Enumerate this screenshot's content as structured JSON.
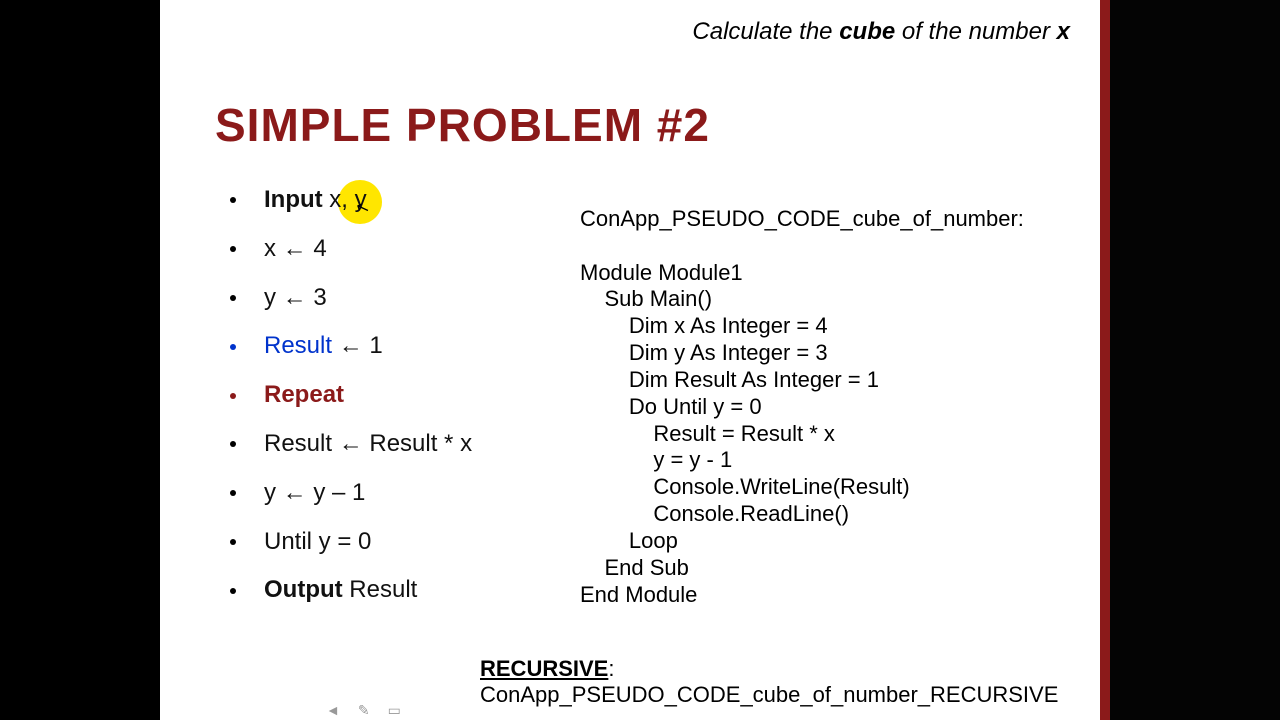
{
  "header": {
    "prefix": "Calculate the ",
    "bold1": "cube",
    "mid": " of the number ",
    "bold2": "x"
  },
  "title": "SIMPLE PROBLEM #2",
  "bullets": [
    {
      "style": "black",
      "html_label": "Input",
      "html_rest": " x, y",
      "bold_first": true
    },
    {
      "style": "black",
      "text": "x ← 4"
    },
    {
      "style": "black",
      "text": "y ← 3"
    },
    {
      "style": "blue",
      "html_label": "Result",
      "html_rest": " ← 1",
      "color_first": "blue"
    },
    {
      "style": "red",
      "html_label": "Repeat",
      "bold_first": true,
      "color_first": "red"
    },
    {
      "style": "black",
      "text": "Result ← Result * x"
    },
    {
      "style": "black",
      "text": "y ← y – 1"
    },
    {
      "style": "black",
      "text": "Until y = 0"
    },
    {
      "style": "black",
      "html_label": "Output",
      "html_rest": " Result",
      "bold_first": true
    }
  ],
  "code": {
    "line0": "ConApp_PSEUDO_CODE_cube_of_number:",
    "line1": "",
    "line2": "Module Module1",
    "line3": "    Sub Main()",
    "line4": "        Dim x As Integer = 4",
    "line5": "        Dim y As Integer = 3",
    "line6": "        Dim Result As Integer = 1",
    "line7": "        Do Until y = 0",
    "line8": "            Result = Result * x",
    "line9": "            y = y - 1",
    "line10": "            Console.WriteLine(Result)",
    "line11": "            Console.ReadLine()",
    "line12": "        Loop",
    "line13": "    End Sub",
    "line14": "End Module"
  },
  "footer": {
    "label": "RECURSIVE",
    "rest": ": ConApp_PSEUDO_CODE_cube_of_number_RECURSIVE"
  },
  "toolbar": {
    "prev": "◄",
    "pen": "✎",
    "menu": "▭"
  }
}
